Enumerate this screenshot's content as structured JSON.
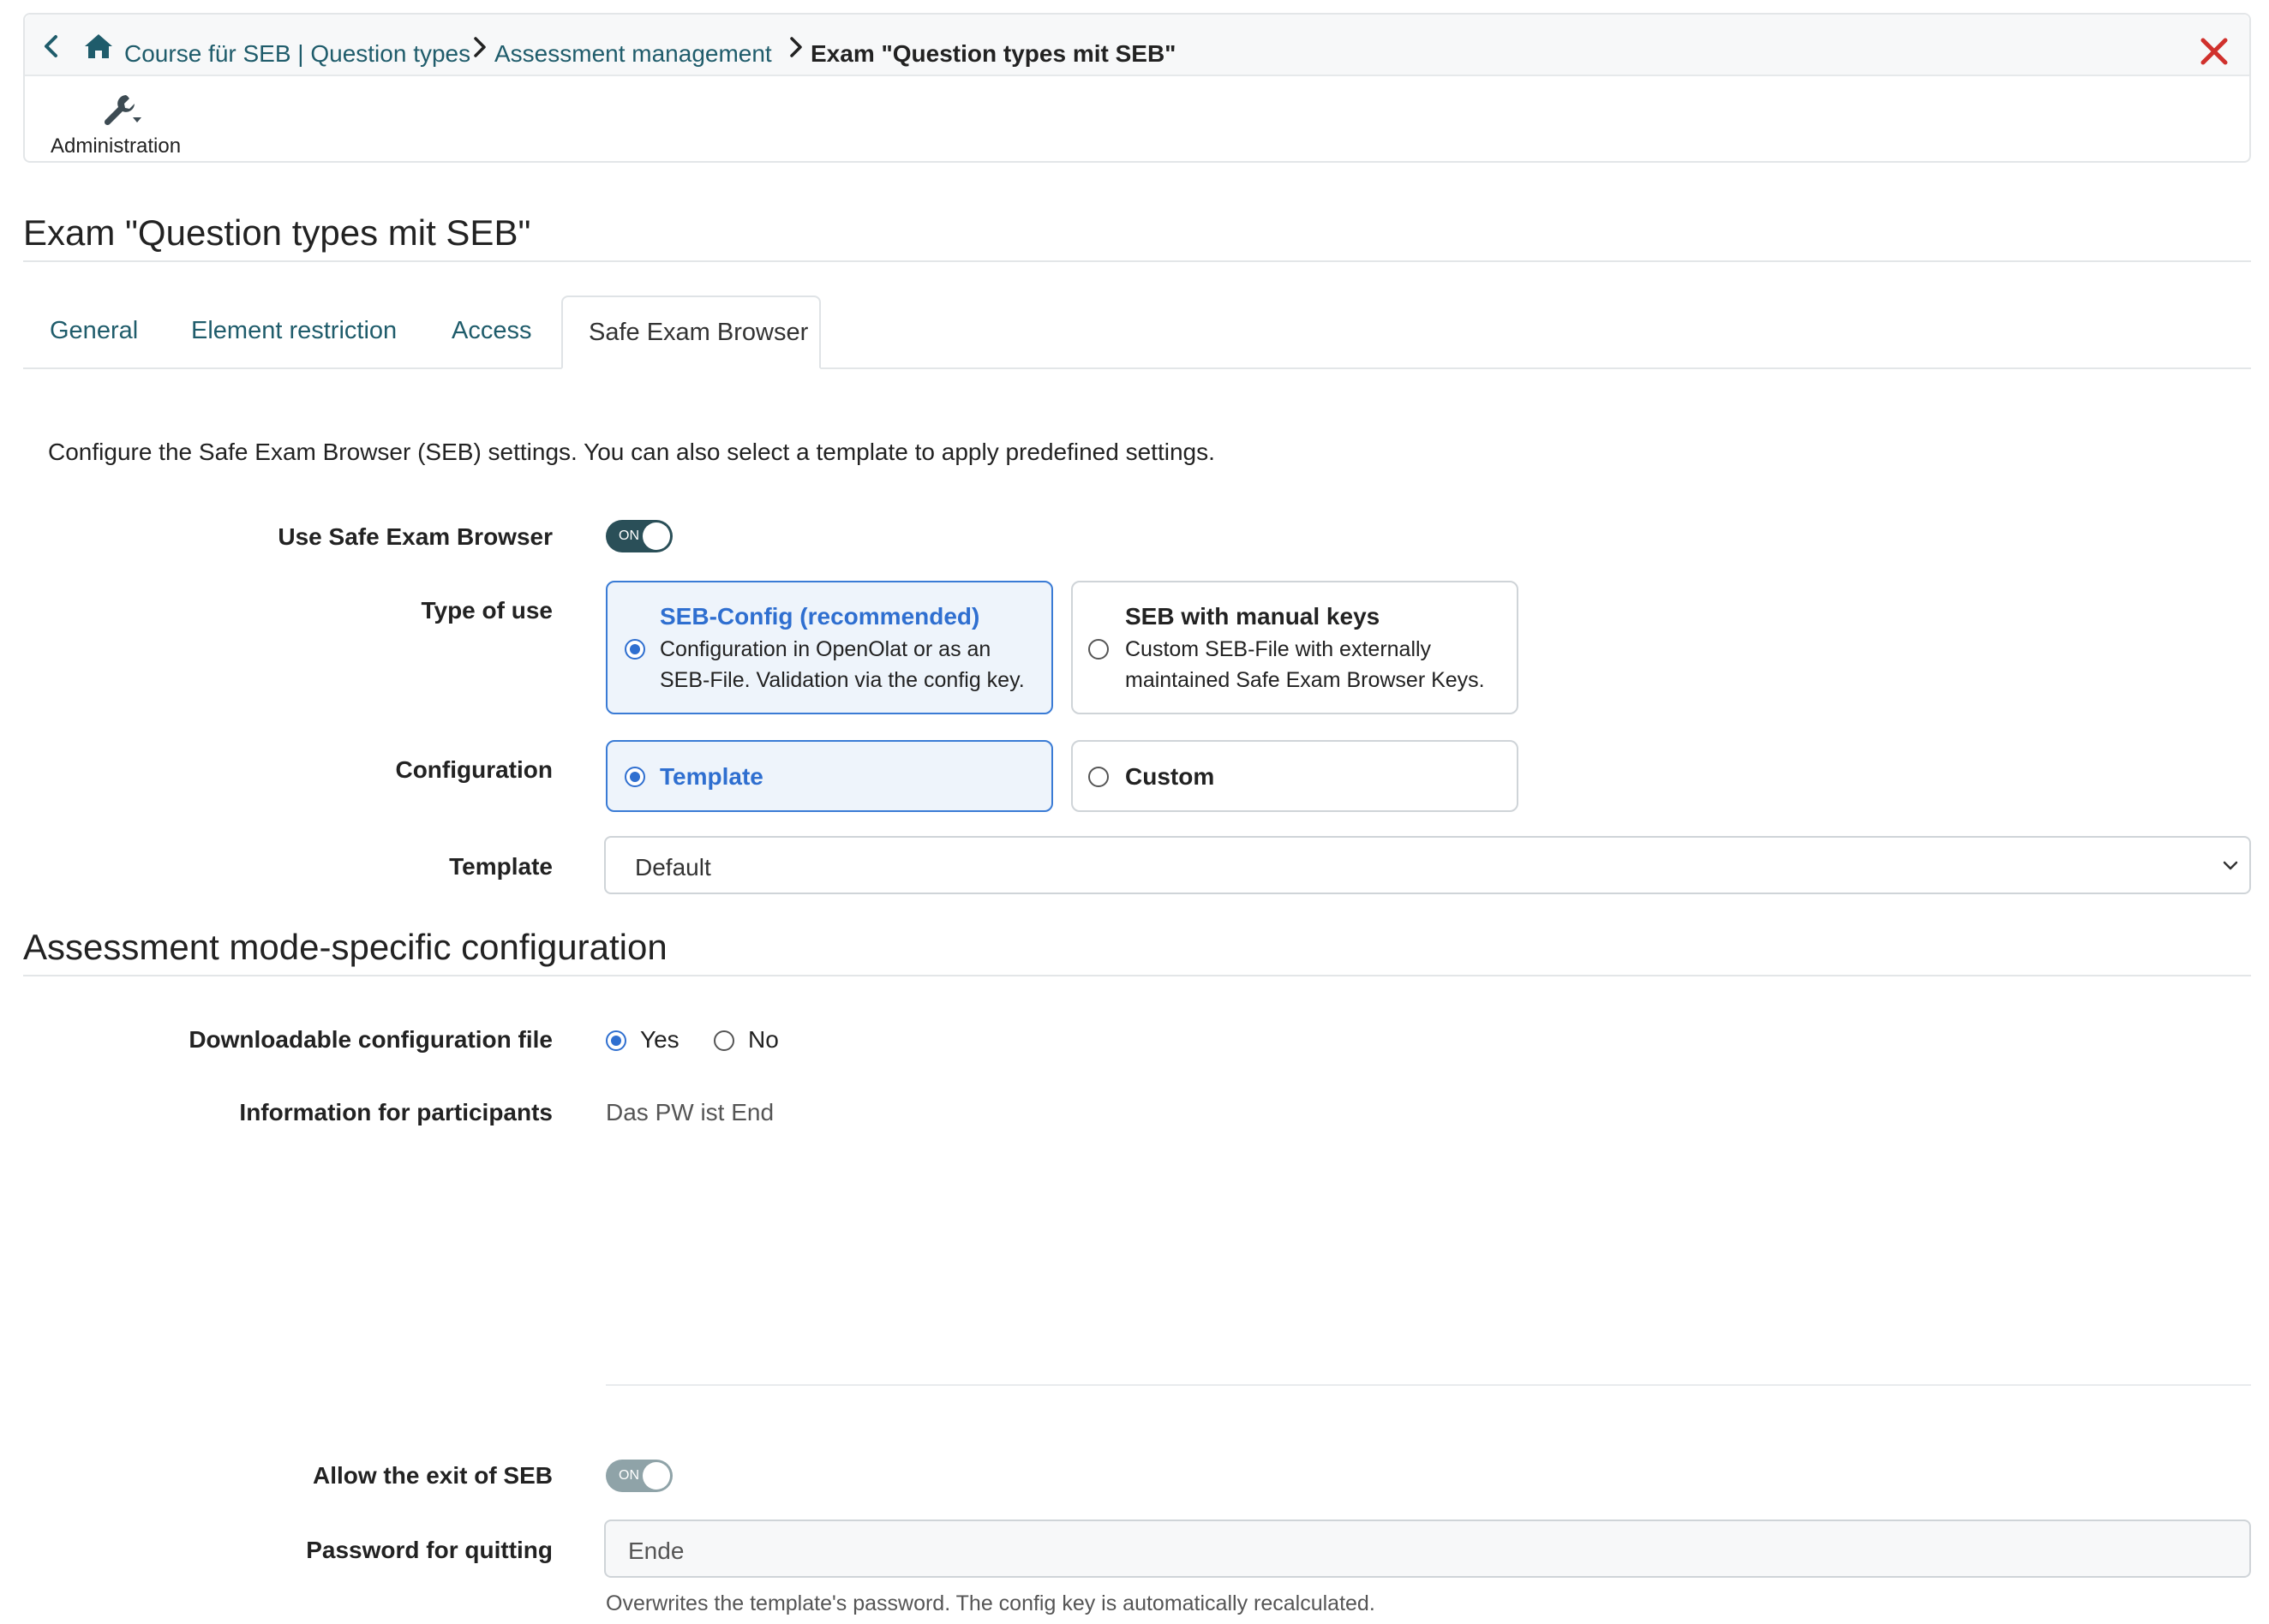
{
  "breadcrumb": {
    "items": [
      "Course für SEB | Question types",
      "Assessment management"
    ],
    "current": "Exam \"Question types mit SEB\"",
    "separator": ">"
  },
  "toolbar": {
    "admin_label": "Administration"
  },
  "page_title": "Exam \"Question types mit SEB\"",
  "tabs": [
    {
      "label": "General"
    },
    {
      "label": "Element restriction"
    },
    {
      "label": "Access"
    },
    {
      "label": "Safe Exam Browser",
      "active": true
    }
  ],
  "intro": "Configure the Safe Exam Browser (SEB) settings. You can also select a template to apply predefined settings.",
  "form": {
    "use_seb": {
      "label": "Use Safe Exam Browser",
      "toggle_text": "ON",
      "state": true
    },
    "type_of_use": {
      "label": "Type of use",
      "options": [
        {
          "title": "SEB-Config (recommended)",
          "desc_1": "Configuration in OpenOlat or as an",
          "desc_2": "SEB-File. Validation via the config key.",
          "selected": true
        },
        {
          "title": "SEB with manual keys",
          "desc_1": "Custom SEB-File with externally",
          "desc_2": "maintained Safe Exam Browser Keys.",
          "selected": false
        }
      ]
    },
    "configuration": {
      "label": "Configuration",
      "options": [
        {
          "title": "Template",
          "selected": true
        },
        {
          "title": "Custom",
          "selected": false
        }
      ]
    },
    "template": {
      "label": "Template",
      "value": "Default"
    }
  },
  "section2": {
    "title": "Assessment mode-specific configuration",
    "downloadable": {
      "label": "Downloadable configuration file",
      "yes": "Yes",
      "no": "No",
      "selected": "Yes"
    },
    "info": {
      "label": "Information for participants",
      "value": "Das PW ist End"
    },
    "allow_exit": {
      "label": "Allow the exit of SEB",
      "toggle_text": "ON",
      "state": true
    },
    "password": {
      "label": "Password for quitting",
      "value": "Ende",
      "help": "Overwrites the template's password. The config key is automatically recalculated."
    }
  },
  "colors": {
    "link": "#1f5c6b",
    "accent_blue": "#2f6fd0",
    "toggle_on": "#2a4f58",
    "toggle_disabled": "#8fa3a8",
    "close": "#d0312d"
  }
}
